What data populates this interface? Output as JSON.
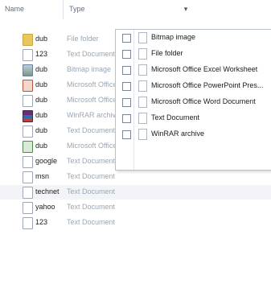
{
  "header": {
    "name_label": "Name",
    "type_label": "Type",
    "dropdown_arrow": "▾"
  },
  "files": [
    {
      "name": "dub",
      "type": "File folder",
      "icon": "folder-icon"
    },
    {
      "name": "123",
      "type": "Text Document",
      "icon": "text-document-icon"
    },
    {
      "name": "dub",
      "type": "Bitmap image",
      "icon": "bitmap-image-icon"
    },
    {
      "name": "dub",
      "type": "Microsoft Office PowerPoint Presentation",
      "icon": "powerpoint-icon"
    },
    {
      "name": "dub",
      "type": "Microsoft Office Word Document",
      "icon": "word-document-icon"
    },
    {
      "name": "dub",
      "type": "WinRAR archive",
      "icon": "winrar-archive-icon"
    },
    {
      "name": "dub",
      "type": "Text Document",
      "icon": "text-document-icon"
    },
    {
      "name": "dub",
      "type": "Microsoft Office Excel Worksheet",
      "icon": "excel-worksheet-icon"
    },
    {
      "name": "google",
      "type": "Text Document",
      "icon": "text-document-icon"
    },
    {
      "name": "msn",
      "type": "Text Document",
      "icon": "text-document-icon"
    },
    {
      "name": "technet",
      "type": "Text Document",
      "icon": "text-document-icon"
    },
    {
      "name": "yahoo",
      "type": "Text Document",
      "icon": "text-document-icon"
    },
    {
      "name": "123",
      "type": "Text Document",
      "icon": "text-document-icon"
    }
  ],
  "filter": {
    "options": [
      {
        "label": "Bitmap image",
        "checked": false
      },
      {
        "label": "File folder",
        "checked": false
      },
      {
        "label": "Microsoft Office Excel Worksheet",
        "checked": false
      },
      {
        "label": "Microsoft Office PowerPoint Pres...",
        "checked": false
      },
      {
        "label": "Microsoft Office Word Document",
        "checked": false
      },
      {
        "label": "Text Document",
        "checked": false
      },
      {
        "label": "WinRAR archive",
        "checked": false
      }
    ]
  }
}
